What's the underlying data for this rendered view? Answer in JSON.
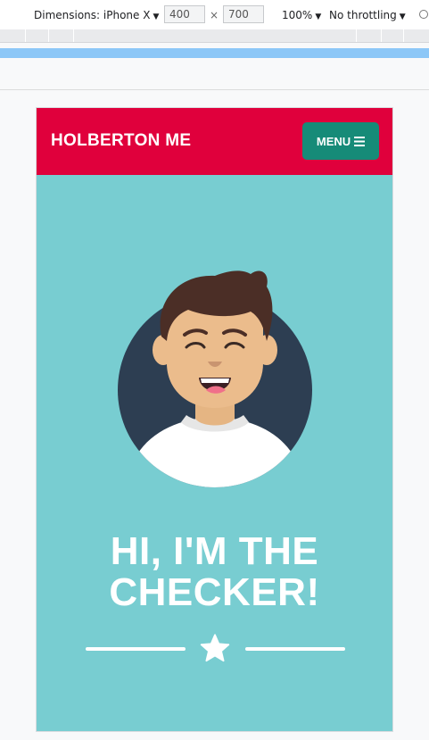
{
  "devtools": {
    "dimensions_label": "Dimensions: iPhone X",
    "width_value": "400",
    "height_value": "700",
    "times": "×",
    "zoom": "100%",
    "throttling": "No throttling"
  },
  "site": {
    "brand": "HOLBERTON ME",
    "menu_label": "MENU",
    "headline_line1": "HI, I'M THE",
    "headline_line2": "CHECKER!"
  },
  "colors": {
    "header": "#e0003c",
    "menu_button": "#168b78",
    "hero_background": "#78cdd1"
  },
  "icons": {
    "menu": "hamburger-icon",
    "divider": "star-icon",
    "rotate": "rotate-icon"
  }
}
